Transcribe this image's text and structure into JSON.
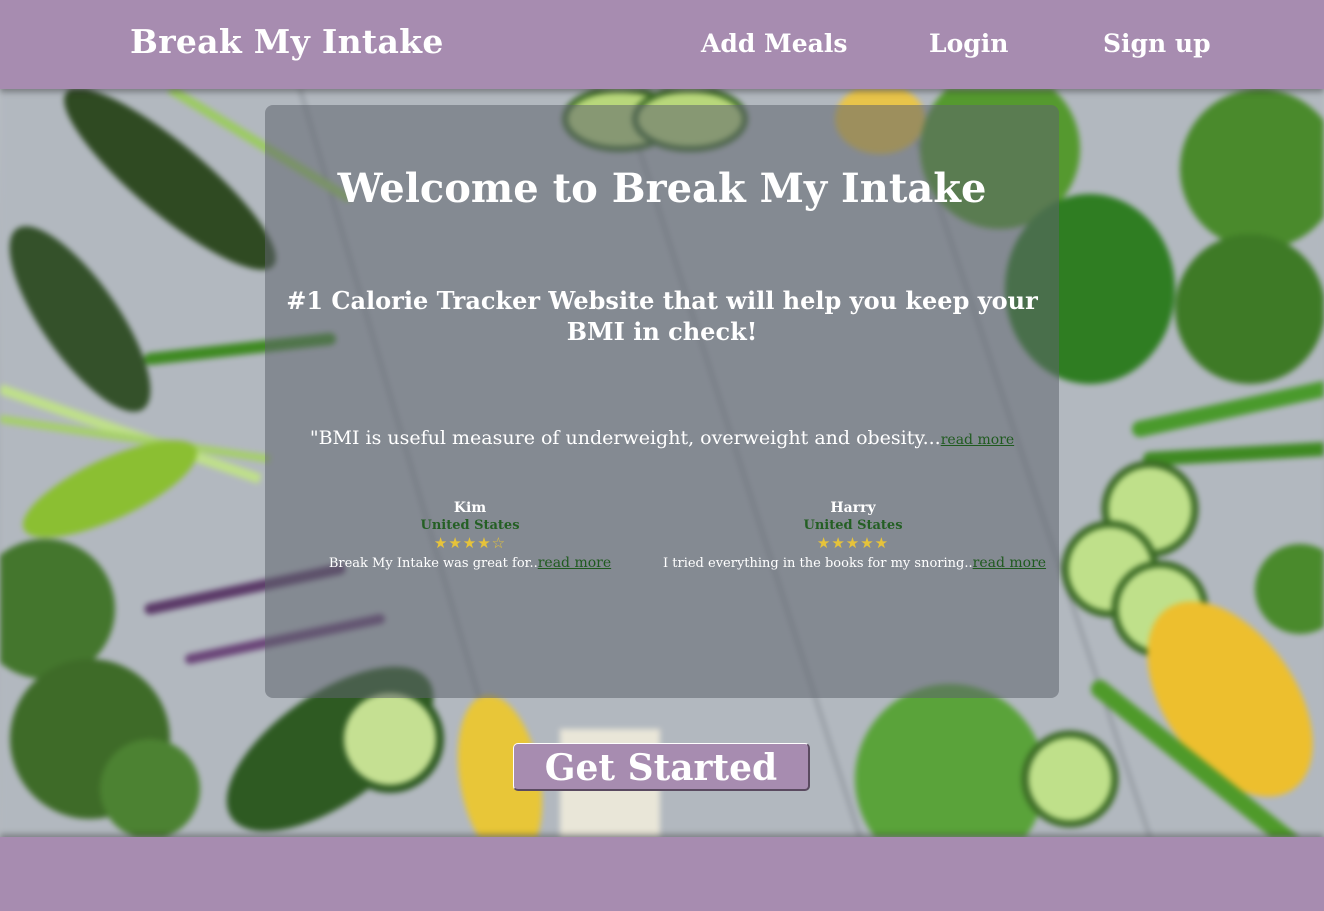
{
  "nav": {
    "brand": "Break My Intake",
    "links": [
      "Add Meals",
      "Login",
      "Sign up"
    ]
  },
  "hero": {
    "title": "Welcome to Break My Intake",
    "subtitle": "#1 Calorie Tracker Website that will help you keep your BMI in check!",
    "quote": "\"BMI is useful measure of underweight, overweight and obesity...",
    "quote_link": "read more"
  },
  "reviews": [
    {
      "name": "Kim",
      "country": "United States",
      "stars": "★★★★☆",
      "rating": 4,
      "text": "Break My Intake was great for..",
      "link": "read more"
    },
    {
      "name": "Harry",
      "country": "United States",
      "stars": "★★★★★",
      "rating": 5,
      "text": "I tried everything in the books for my snoring..",
      "link": "read more"
    }
  ],
  "cta": {
    "label": "Get Started"
  },
  "colors": {
    "brand": "#a78cb0",
    "link_green": "#1f5a1f",
    "star_gold": "#e6c33a"
  }
}
